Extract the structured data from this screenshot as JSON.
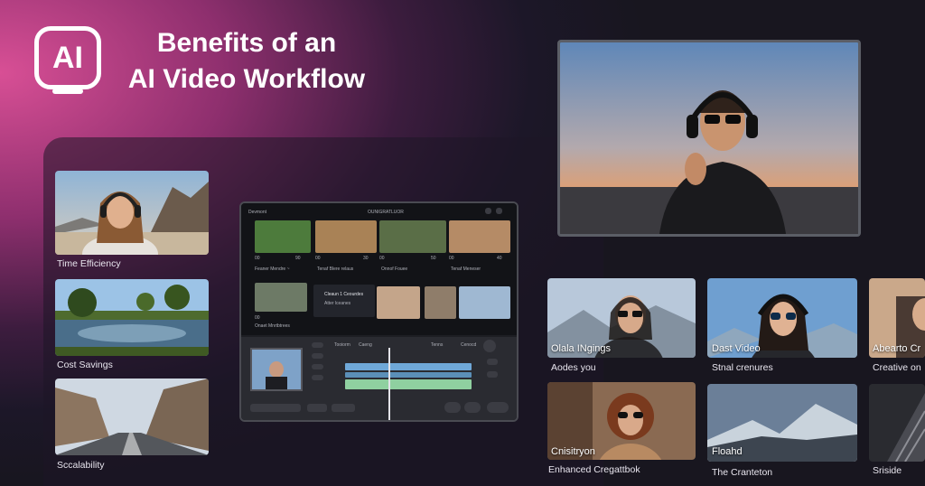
{
  "header": {
    "logo_text": "AI",
    "title_line1": "Benefits of an",
    "title_line2": "AI Video Workflow"
  },
  "left_cards": [
    {
      "label": "Time Efficiency",
      "icon": "woman-headphones-photo"
    },
    {
      "label": "Cost Savings",
      "icon": "lake-landscape-photo"
    },
    {
      "label": "Sccalability",
      "icon": "mountain-road-photo"
    }
  ],
  "editor": {
    "window_title": "Devmont",
    "header_center": "OUNIGRATLUOR",
    "clip_labels": [
      "Feaner Mendre  ~",
      "Tenaf Blere relaus",
      "Onnof Fouee",
      "Tenaf Meneser"
    ],
    "clip_timecodes": [
      "00",
      "00",
      "00",
      "00"
    ],
    "clip_values": [
      "90",
      "30",
      "50",
      "40"
    ],
    "lower_clip_label": "Onaet Mnrtbtrees",
    "lower_clip_timecode": "00",
    "detail_title": "Cleaun 1 Ceourdes",
    "detail_sub": "Atter lceanes",
    "timeline_labels": [
      "Tooiorm",
      "Caeng",
      "Tenns",
      "Cenocd"
    ]
  },
  "right_cards": [
    {
      "overlay": "Olala INgings",
      "caption": "Aodes you"
    },
    {
      "overlay": "Dast Video",
      "caption": "Stnal crenures"
    },
    {
      "overlay": "Abearto Cr",
      "caption": "Creative on"
    },
    {
      "overlay": "Cnisitryon",
      "caption": "Enhanced Cregattbok"
    },
    {
      "overlay": "Floahd",
      "caption": "The Cranteton"
    },
    {
      "overlay": "",
      "caption": "Sriside"
    }
  ],
  "colors": {
    "accent_pink": "#d84f95",
    "background_dark": "#18161f",
    "timeline_clip_green": "#8fd0a0",
    "timeline_clip_blue": "#6fa8d8"
  }
}
